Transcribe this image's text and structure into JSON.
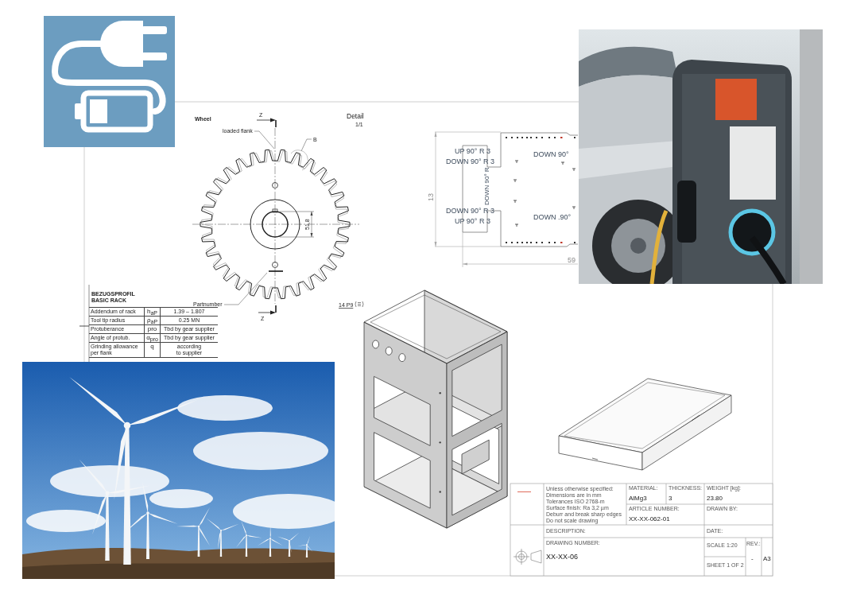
{
  "gear_detail": {
    "wheel_label": "Wheel",
    "section_labels": [
      "Z",
      "Z"
    ],
    "view_title": "Detail",
    "view_scale": "1/1",
    "flank_callout": "loaded flank",
    "detail_callout": "B",
    "part_callout": "Partnumber",
    "bore_dimension": "51,8",
    "keyway_note": "14 P9"
  },
  "gear_data_table": {
    "headings": [
      "BEZUGSPROFIL",
      "BASIC RACK"
    ],
    "rows": [
      {
        "label": "Addendum of rack",
        "symbol": "h$_{aP}$",
        "value": "1.39 – 1.807"
      },
      {
        "label": "Tool tip radius",
        "symbol": "ρ$_{aP}$",
        "value": "0.25 MN"
      },
      {
        "label": "Protuberance",
        "symbol": "pro",
        "value": "Tbd by gear supplier"
      },
      {
        "label": "Angle of protub.",
        "symbol": "α$_{pro}$",
        "value": "Tbd by gear supplier"
      },
      {
        "label": "Grinding allowance per flank",
        "symbol": "q",
        "value": "according\nto supplier"
      }
    ]
  },
  "flat_pattern": {
    "bend_notes": [
      "UP 90° R 3",
      "DOWN 90° R 3",
      "DOWN 90° R",
      "DOWN 90° R 3",
      "UP 90° R 3",
      "DOWN 90°",
      "DOWN .90°"
    ],
    "height_dimension": "13",
    "width_dimension": "59"
  },
  "title_block": {
    "notes": "Unless otherwise specified:\nDimensions are in mm\nTolerances ISO 2768-m\nSurface finish: Ra 3,2 µm\nDeburr and break sharp edges\nDo not scale drawing",
    "material": {
      "label": "MATERIAL:",
      "value": "AlMg3"
    },
    "thickness": {
      "label": "THICKNESS:",
      "value": "3"
    },
    "weight": {
      "label": "WEIGHT [kg]:",
      "value": "23.80"
    },
    "article_number": {
      "label": "ARTICLE NUMBER:",
      "value": "XX-XX-062-01"
    },
    "drawn_by": {
      "label": "DRAWN BY:"
    },
    "description": {
      "label": "DESCRIPTION:"
    },
    "date": {
      "label": "DATE:"
    },
    "drawing_number": {
      "label": "DRAWING NUMBER:",
      "value": "XX-XX-06"
    },
    "scale": {
      "label": "SCALE 1:20"
    },
    "revision": {
      "label": "REV.:",
      "value": "-"
    },
    "sheet": {
      "label": "SHEET 1 OF 2"
    },
    "format": "A3"
  }
}
